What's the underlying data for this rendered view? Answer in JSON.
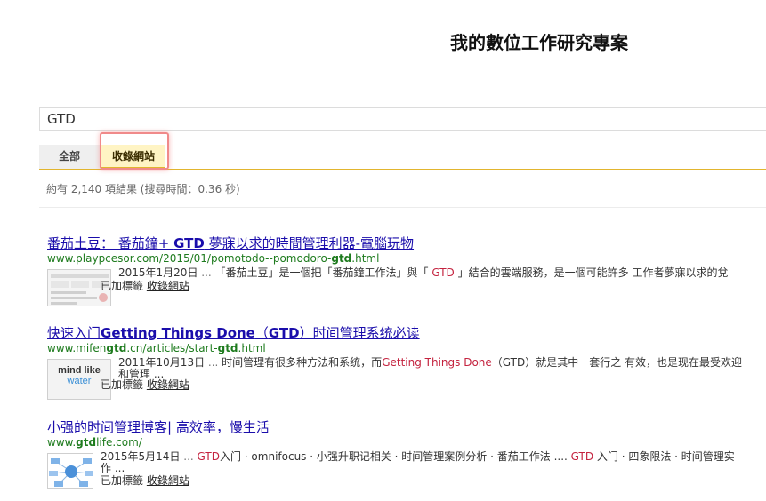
{
  "header": {
    "title": "我的數位工作研究專案"
  },
  "search": {
    "query": "GTD"
  },
  "tabs": [
    {
      "label": "全部"
    },
    {
      "label": "收錄網站"
    }
  ],
  "result_stats": "約有 2,140 項結果 (搜尋時間：0.36 秒)",
  "results": [
    {
      "title_pre": "番茄土豆： 番茄鐘+ ",
      "title_bold": "GTD",
      "title_post": " 夢寐以求的時間管理利器-電腦玩物",
      "url_pre": "www.playpcesor.com/2015/01/pomotodo--pomodoro-",
      "url_bold": "gtd",
      "url_post": ".html",
      "date": "2015年1月20日",
      "ellipsis": " ... ",
      "snippet_a": "「番茄土豆」是一個把「番茄鐘工作法」與「 ",
      "snippet_hl": "GTD",
      "snippet_b": " 」結合的雲端服務，是一個可能許多 工作者夢寐以求的兌",
      "snippet_line2": "",
      "tag_label": "已加標籤",
      "tag_link": "收錄網站"
    },
    {
      "title_pre": "快速入门",
      "title_bold": "Getting Things Done",
      "title_mid": "（",
      "title_bold2": "GTD",
      "title_post": "）时间管理系统必读",
      "url_pre": "www.mifen",
      "url_bold": "gtd",
      "url_mid": ".cn/articles/start-",
      "url_bold2": "gtd",
      "url_post": ".html",
      "date": "2011年10月13日",
      "ellipsis": " ... ",
      "snippet_a": "时间管理有很多种方法和系统，而",
      "snippet_hl": "Getting Things Done",
      "snippet_b": "（GTD）就是其中一套行之 有效，也是现在最受欢迎",
      "snippet_line2": "和管理 ...",
      "thumb_text_1": "mind like",
      "thumb_text_2": "water",
      "tag_label": "已加標籤",
      "tag_link": "收錄網站"
    },
    {
      "title": "小强的时间管理博客| 高效率，慢生活",
      "url_pre": "www.",
      "url_bold": "gtd",
      "url_post": "life.com/",
      "date": "2015年5月14日",
      "ellipsis": " ... ",
      "snippet_hl": "GTD",
      "snippet_a": "入门 · omnifocus · 小强升职记相关 · 时间管理案例分析 · 番茄工作法 .... ",
      "snippet_hl2": "GTD",
      "snippet_b": " 入门 · 四象限法 · 时间管理实",
      "snippet_line2": "作 ...",
      "tag_label": "已加標籤",
      "tag_link": "收錄網站"
    }
  ],
  "colors": {
    "link": "#1a0dab",
    "url": "#1e7b1e",
    "highlight": "#c4233f",
    "tab_accent": "#e2b52e",
    "annotation": "#f08a8a"
  }
}
